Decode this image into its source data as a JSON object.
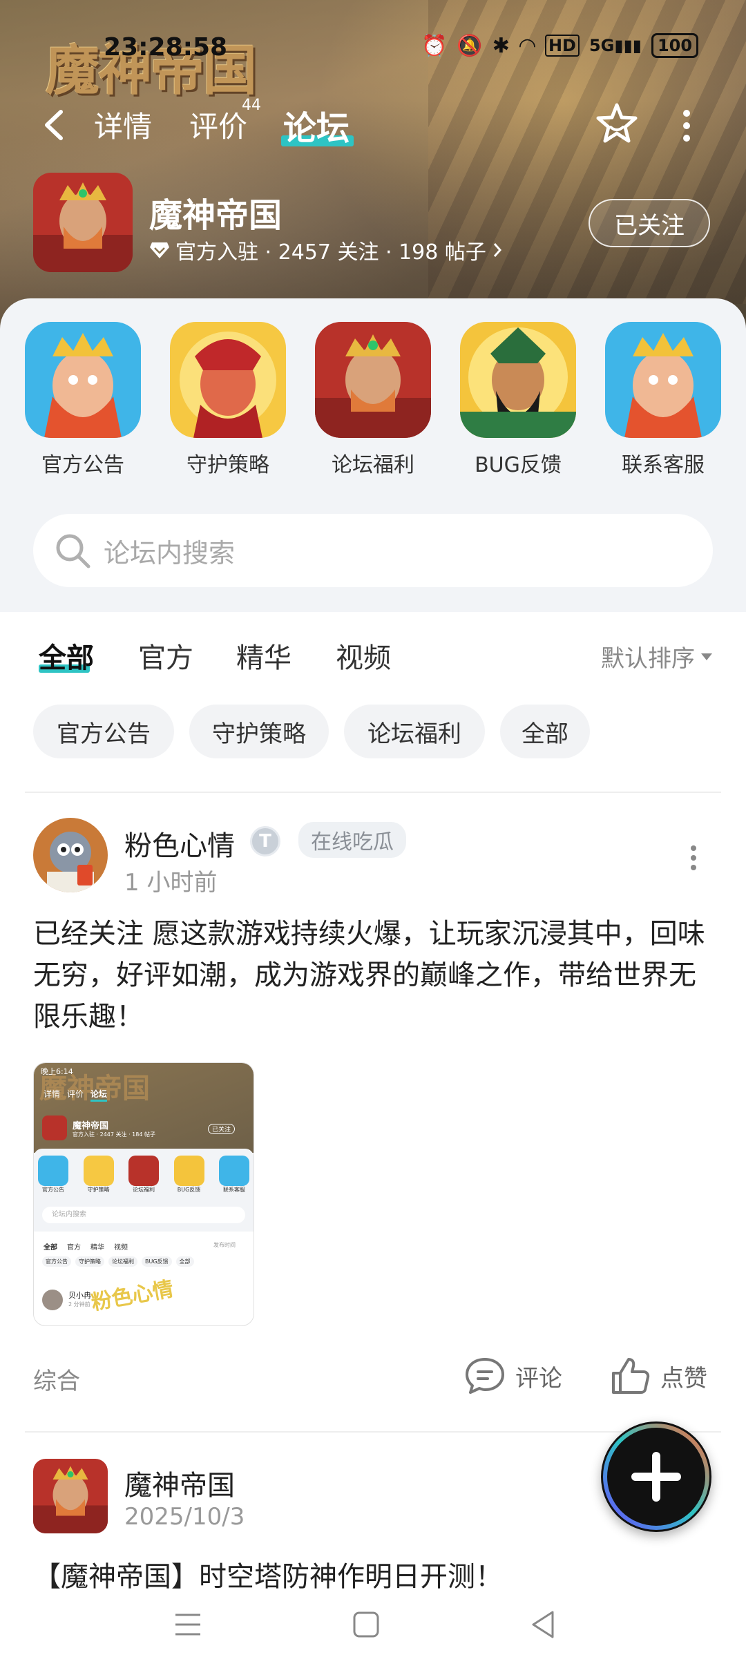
{
  "status_bar": {
    "time": "23:28:58",
    "network": "HD",
    "signal": "5G",
    "battery": "100"
  },
  "top_nav": {
    "tabs": [
      {
        "label": "详情"
      },
      {
        "label": "评价",
        "badge": "44"
      },
      {
        "label": "论坛",
        "active": true
      }
    ]
  },
  "banner": {
    "logo_text": "魔神帝国"
  },
  "game": {
    "name": "魔神帝国",
    "meta": "官方入驻 · 2457 关注 · 198 帖子",
    "follow_label": "已关注"
  },
  "categories": [
    {
      "label": "官方公告"
    },
    {
      "label": "守护策略"
    },
    {
      "label": "论坛福利"
    },
    {
      "label": "BUG反馈"
    },
    {
      "label": "联系客服"
    }
  ],
  "search": {
    "placeholder": "论坛内搜索"
  },
  "filter_tabs": [
    {
      "label": "全部",
      "active": true
    },
    {
      "label": "官方"
    },
    {
      "label": "精华"
    },
    {
      "label": "视频"
    }
  ],
  "sort": {
    "label": "默认排序"
  },
  "chips": [
    {
      "label": "官方公告"
    },
    {
      "label": "守护策略"
    },
    {
      "label": "论坛福利"
    },
    {
      "label": "全部"
    }
  ],
  "posts": [
    {
      "user": "粉色心情",
      "badge": "T",
      "tag": "在线吃瓜",
      "time": "1 小时前",
      "text": "已经关注  愿这款游戏持续火爆，让玩家沉浸其中，回味无穷，好评如潮，成为游戏界的巅峰之作，带给世界无限乐趣！",
      "category": "综合",
      "comment_label": "评论",
      "like_label": "点赞",
      "screenshot": {
        "status_time": "晚上6:14",
        "tabs": [
          "详情",
          "评价",
          "论坛"
        ],
        "game_name": "魔神帝国",
        "meta": "官方入驻 · 2447 关注 · 184 帖子",
        "follow_label": "已关注",
        "categories": [
          "官方公告",
          "守护策略",
          "论坛福利",
          "BUG反馈",
          "联系客服"
        ],
        "search_placeholder": "论坛内搜索",
        "filter_tabs": [
          "全部",
          "官方",
          "精华",
          "视频"
        ],
        "sort": "发布时间",
        "chips": [
          "官方公告",
          "守护策略",
          "论坛福利",
          "BUG反馈",
          "全部"
        ],
        "user": "贝小冉",
        "time": "2 分钟前",
        "watermark": "粉色心情"
      }
    },
    {
      "user": "魔神帝国",
      "time": "2025/10/3",
      "text": "【魔神帝国】时空塔防神作明日开测！"
    }
  ],
  "colors": {
    "accent": "#2ec4c4",
    "fab": "#111111"
  }
}
